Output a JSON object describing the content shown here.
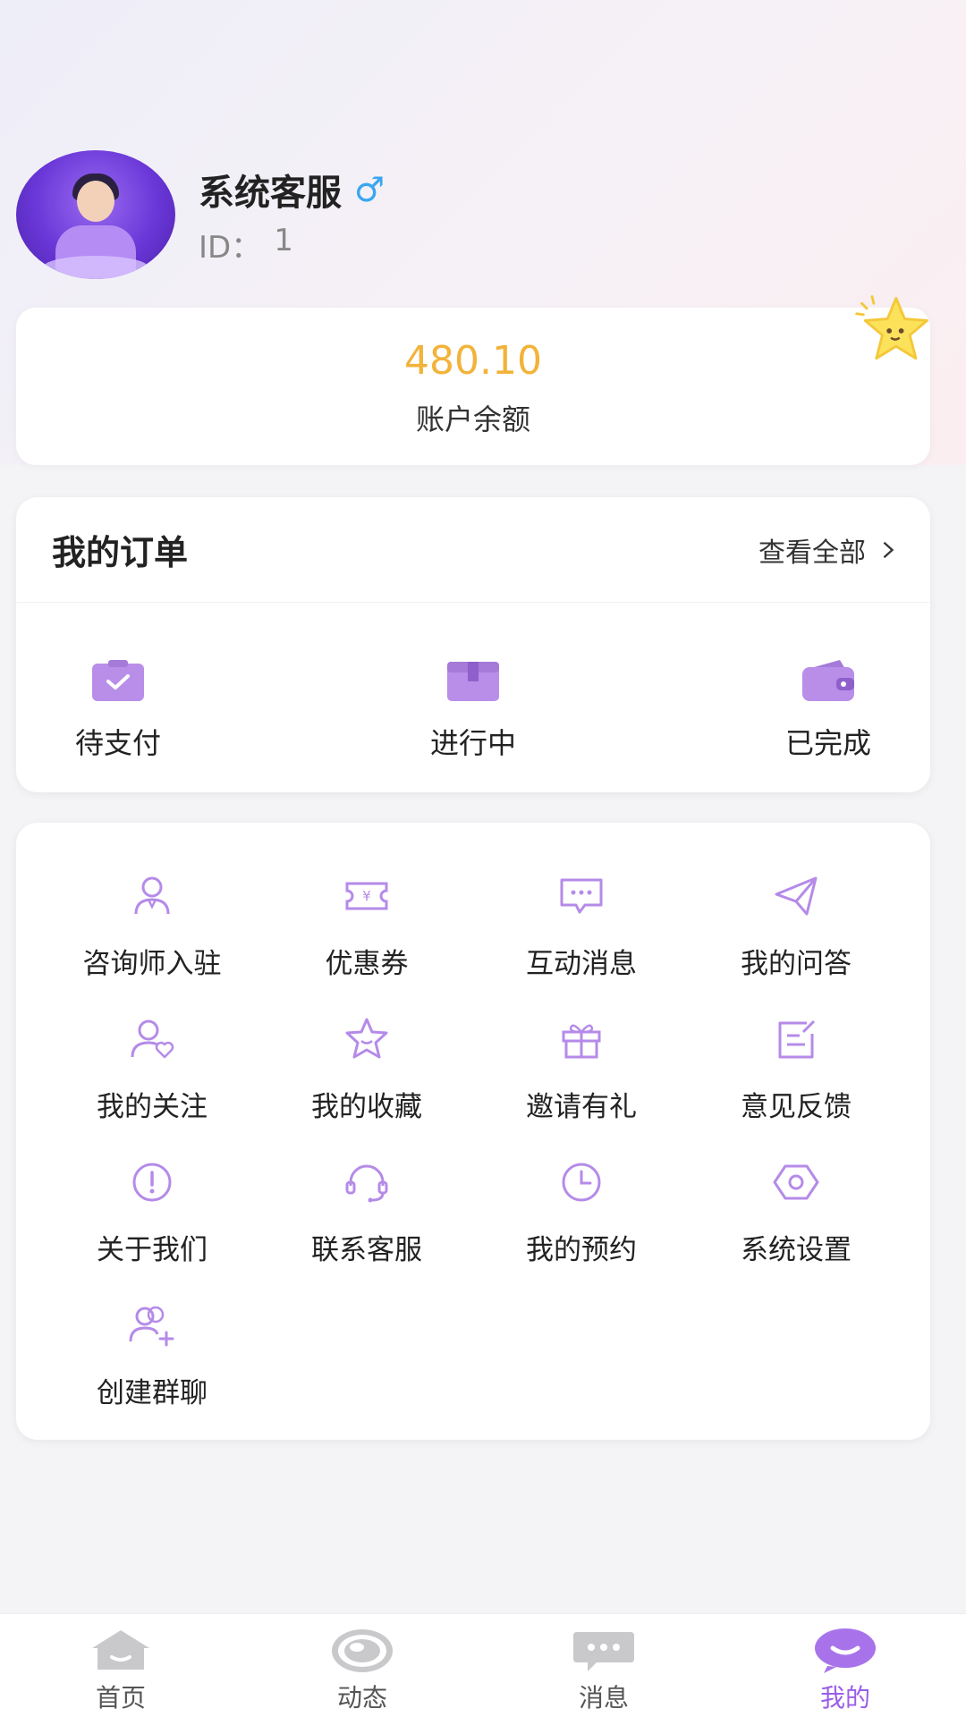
{
  "profile": {
    "name": "系统客服",
    "gender_symbol": "♂",
    "id_label": "ID：",
    "id_value": "1"
  },
  "balance": {
    "value": "480.10",
    "label": "账户余额"
  },
  "orders": {
    "title": "我的订单",
    "view_all": "查看全部",
    "items": [
      {
        "label": "待支付",
        "icon": "clipboard-check-icon"
      },
      {
        "label": "进行中",
        "icon": "box-icon"
      },
      {
        "label": "已完成",
        "icon": "wallet-icon"
      }
    ]
  },
  "menu": {
    "items": [
      {
        "label": "咨询师入驻",
        "icon": "person-icon"
      },
      {
        "label": "优惠券",
        "icon": "coupon-icon"
      },
      {
        "label": "互动消息",
        "icon": "chat-bubble-icon"
      },
      {
        "label": "我的问答",
        "icon": "paper-plane-icon"
      },
      {
        "label": "我的关注",
        "icon": "person-heart-icon"
      },
      {
        "label": "我的收藏",
        "icon": "star-icon"
      },
      {
        "label": "邀请有礼",
        "icon": "gift-icon"
      },
      {
        "label": "意见反馈",
        "icon": "edit-note-icon"
      },
      {
        "label": "关于我们",
        "icon": "info-icon"
      },
      {
        "label": "联系客服",
        "icon": "headset-icon"
      },
      {
        "label": "我的预约",
        "icon": "clock-icon"
      },
      {
        "label": "系统设置",
        "icon": "hexagon-settings-icon"
      },
      {
        "label": "创建群聊",
        "icon": "group-add-icon"
      }
    ]
  },
  "tabbar": {
    "tabs": [
      {
        "label": "首页",
        "icon": "home-icon"
      },
      {
        "label": "动态",
        "icon": "eye-icon"
      },
      {
        "label": "消息",
        "icon": "message-icon"
      },
      {
        "label": "我的",
        "icon": "smile-icon",
        "active": true
      }
    ]
  },
  "colors": {
    "accent": "#9a5ee8",
    "icon_purple": "#b58be8",
    "balance_yellow": "#f2b33a",
    "gender_blue": "#3aa6ef"
  }
}
